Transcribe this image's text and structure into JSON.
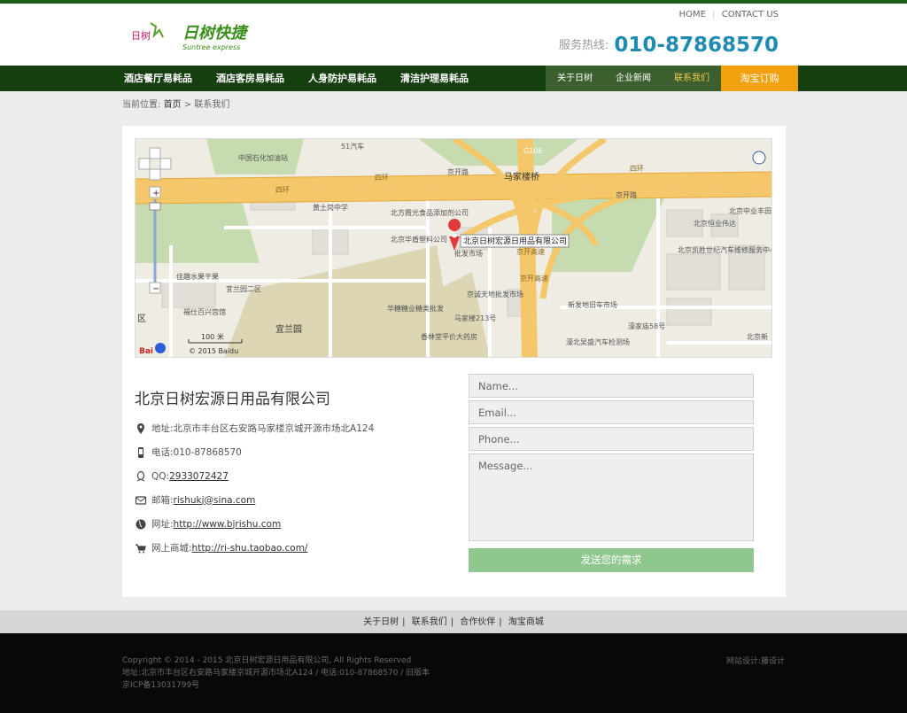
{
  "header": {
    "logo_cn": "日树快捷",
    "logo_en": "Suntree express",
    "logo_mark": "日树",
    "top_links": [
      "HOME",
      "CONTACT US"
    ],
    "hotline_label": "服务热线:",
    "hotline_number": "010-87868570"
  },
  "nav": {
    "left": [
      "酒店餐厅易耗品",
      "酒店客房易耗品",
      "人身防护易耗品",
      "清洁护理易耗品"
    ],
    "right": [
      "关于日树",
      "企业新闻",
      "联系我们"
    ],
    "taobao": "淘宝订购"
  },
  "breadcrumb": {
    "prefix": "当前位置:",
    "home": "首页",
    "sep": ">",
    "current": "联系我们"
  },
  "map": {
    "marker_label": "北京日树宏源日用品有限公司",
    "scale": "100 米",
    "copyright": "© 2015 Baidu",
    "labels": [
      "中国石化加油站",
      "51汽车",
      "G106",
      "四环",
      "马家楼桥",
      "京开路",
      "四环",
      "四环",
      "黄土岗中学",
      "北方霞光食品添加剂公司",
      "北京华盾塑料公司",
      "批发市场",
      "北京中业丰田",
      "北京恒业伟达",
      "北京凯胜世纪汽车维修服务中心",
      "佳趣水果干果",
      "宜兰园二区",
      "福仕百兴宫馆",
      "京诚天地批发市场",
      "华糖糖业糖类批发",
      "马家楼213号",
      "新发地旧车市场",
      "濠家庙58号",
      "宜兰园",
      "香林堂平价大药房",
      "濠北吴盛汽车检测场",
      "北京新",
      "京开高速",
      "京开路",
      "京开高速",
      "区"
    ]
  },
  "contact": {
    "company": "北京日树宏源日用品有限公司",
    "address": "地址:北京市丰台区右安路马家楼京城开源市场北A124",
    "phone": "电话:010-87868570",
    "qq_label": "QQ:",
    "qq": "2933072427",
    "email_label": "邮箱:",
    "email": "rishukj@sina.com",
    "site_label": "网址:",
    "site": "http://www.bjrishu.com",
    "shop_label": "网上商城:",
    "shop": "http://ri-shu.taobao.com/"
  },
  "form": {
    "name": "Name...",
    "email": "Email...",
    "phone": "Phone...",
    "message": "Message...",
    "submit": "发送您的需求"
  },
  "footer": {
    "links": [
      "关于日树",
      "联系我们",
      "合作伙伴",
      "淘宝商城"
    ],
    "copyright": "Copyright © 2014 - 2015 北京日树宏源日用品有限公司, All Rights Reserved",
    "address_line": "地址:北京市丰台区右安路马家楼京城开源市场北A124 / 电话:010-87868570 / 旧版本",
    "icp": "京ICP备13031799号",
    "design": "网站设计:藤设计"
  }
}
